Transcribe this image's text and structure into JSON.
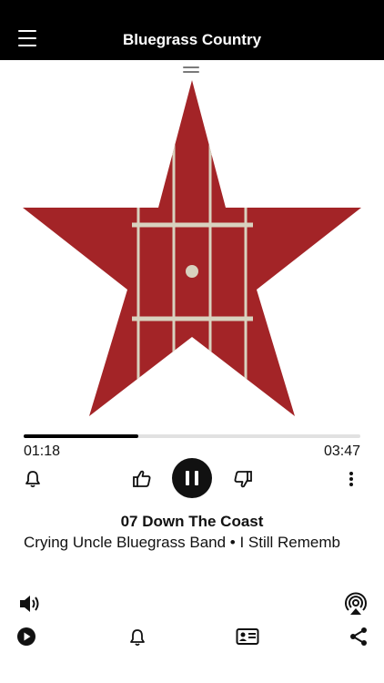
{
  "header": {
    "title": "Bluegrass Country",
    "menu_icon": "hamburger-menu-icon"
  },
  "artwork": {
    "description_icon": "bluegrass-star-logo",
    "star_color": "#a32427",
    "string_color": "#d8d2bf"
  },
  "player": {
    "elapsed": "01:18",
    "duration": "03:47",
    "progress": 0.34,
    "accent": "#000000"
  },
  "controls": {
    "alert_icon": "bell-icon",
    "like_icon": "thumbs-up-icon",
    "play_state_icon": "pause-icon",
    "dislike_icon": "thumbs-down-icon",
    "more_icon": "more-vertical-icon"
  },
  "track": {
    "title": "07 Down The Coast",
    "subtitle": "Crying Uncle Bluegrass Band • I Still Rememb"
  },
  "bottom_bar": {
    "volume_icon": "speaker-volume-icon",
    "airplay_icon": "airplay-icon",
    "play_icon": "play-circle-icon",
    "alerts_icon": "bell-icon",
    "contact_icon": "contact-card-icon",
    "share_icon": "share-icon"
  }
}
